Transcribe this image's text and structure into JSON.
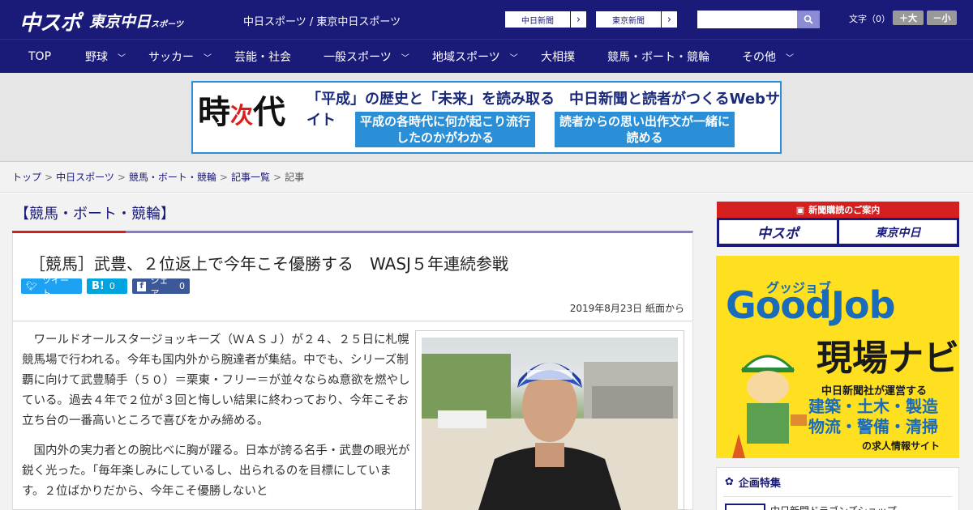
{
  "header": {
    "logo_primary": "中スポ",
    "logo_secondary": "東京中日",
    "logo_secondary_sub": "スポーツ",
    "site_title": "中日スポーツ / 東京中日スポーツ",
    "paper_links": [
      "中日新聞",
      "東京新聞"
    ],
    "font_label": "文字（0）",
    "font_larger": "＋大",
    "font_smaller": "－小"
  },
  "nav": {
    "items": [
      {
        "label": "TOP",
        "has_menu": false
      },
      {
        "label": "野球",
        "has_menu": true
      },
      {
        "label": "サッカー",
        "has_menu": true
      },
      {
        "label": "芸能・社会",
        "has_menu": false
      },
      {
        "label": "一般スポーツ",
        "has_menu": true
      },
      {
        "label": "地域スポーツ",
        "has_menu": true
      },
      {
        "label": "大相撲",
        "has_menu": false
      },
      {
        "label": "競馬・ボート・競輪",
        "has_menu": false
      },
      {
        "label": "その他",
        "has_menu": true
      }
    ]
  },
  "banner": {
    "logo_a": "時",
    "logo_b": "次",
    "logo_c": "代",
    "headline": "「平成」の歴史と「未来」を読み取る　中日新聞と読者がつくるWebサイト",
    "sub_left": "平成の各時代に何が起こり流行したのかがわかる",
    "sub_right": "読者からの思い出作文が一緒に読める"
  },
  "breadcrumb": [
    "トップ",
    "中日スポーツ",
    "競馬・ボート・競輪",
    "記事一覧",
    "記事"
  ],
  "article": {
    "category": "【競馬・ボート・競輪】",
    "title": "［競馬］武豊、２位返上で今年こそ優勝する　WASJ５年連続参戦",
    "share_tweet": "ツイート",
    "share_hatena": "B!",
    "share_hatena_count": "0",
    "share_facebook": "シェア",
    "share_facebook_count": "0",
    "date": "2019年8月23日 紙面から",
    "paragraphs": [
      "ワールドオールスタージョッキーズ（ＷＡＳＪ）が２４、２５日に札幌競馬場で行われる。今年も国内外から腕達者が集結。中でも、シリーズ制覇に向けて武豊騎手（５０）＝栗東・フリー＝が並々ならぬ意欲を燃やしている。過去４年で２位が３回と悔しい結果に終わっており、今年こそお立ち台の一番高いところで喜びをかみ締める。",
      "国内外の実力者との腕比べに胸が躍る。日本が誇る名手・武豊の眼光が鋭く光った。「毎年楽しみにしているし、出られるのを目標にしています。２位ばかりだから、今年こそ優勝しないと"
    ]
  },
  "sidebar": {
    "subscribe_title": "新聞購読のご案内",
    "subscribe_btn_a": "中スポ",
    "subscribe_btn_b": "東京中日",
    "goodjob_kana": "グッジョブ",
    "goodjob_title": "GoodJob",
    "goodjob_navi": "現場ナビ",
    "goodjob_line1": "中日新聞社が運営する",
    "goodjob_line2a": "建築・土木・製造",
    "goodjob_line2b": "物流・警備・清掃",
    "goodjob_line3": "の求人情報サイト",
    "feature_title": "企画特集",
    "feature_item": "中日新聞ドラゴンズショップ"
  },
  "colors": {
    "brand_navy": "#1a1a78",
    "accent_red": "#d62020",
    "twitter": "#1da1f2",
    "hatena": "#00a4de",
    "facebook": "#3b5998",
    "goodjob_yellow": "#ffe020"
  }
}
